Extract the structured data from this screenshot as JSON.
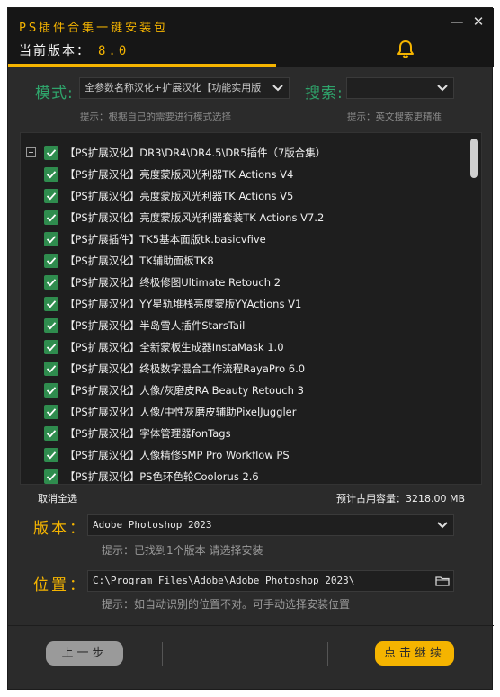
{
  "app": {
    "title": "PS插件合集一键安装包",
    "version_label": "当前版本：",
    "version_value": "8.0"
  },
  "colors": {
    "accent": "#f5b400",
    "green": "#2fa46b",
    "check": "#2f8c4e",
    "bg": "#2b2b2b"
  },
  "mode": {
    "label": "模式:",
    "value": "全参数名称汉化+扩展汉化【功能实用版",
    "hint": "提示：根据自己的需要进行模式选择"
  },
  "search": {
    "label": "搜索:",
    "value": "",
    "hint": "提示：英文搜索更精准"
  },
  "items": [
    {
      "label": "【PS扩展汉化】DR3\\DR4\\DR4.5\\DR5插件（7版合集）",
      "checked": true,
      "expander": true
    },
    {
      "label": "【PS扩展汉化】亮度蒙版风光利器TK Actions V4",
      "checked": true
    },
    {
      "label": "【PS扩展汉化】亮度蒙版风光利器TK Actions V5",
      "checked": true
    },
    {
      "label": "【PS扩展汉化】亮度蒙版风光利器套装TK Actions V7.2",
      "checked": true
    },
    {
      "label": "【PS扩展插件】TK5基本面版tk.basicvfive",
      "checked": true
    },
    {
      "label": "【PS扩展汉化】TK辅助面板TK8",
      "checked": true
    },
    {
      "label": "【PS扩展汉化】终极修图Ultimate Retouch 2",
      "checked": true
    },
    {
      "label": "【PS扩展汉化】YY星轨堆栈亮度蒙版YYActions V1",
      "checked": true
    },
    {
      "label": "【PS扩展汉化】半岛雪人插件StarsTail",
      "checked": true
    },
    {
      "label": "【PS扩展汉化】全新蒙板生成器InstaMask 1.0",
      "checked": true
    },
    {
      "label": "【PS扩展汉化】终极数字混合工作流程RayaPro 6.0",
      "checked": true
    },
    {
      "label": "【PS扩展汉化】人像/灰磨皮RA Beauty Retouch 3",
      "checked": true
    },
    {
      "label": "【PS扩展汉化】人像/中性灰磨皮辅助PixelJuggler",
      "checked": true
    },
    {
      "label": "【PS扩展汉化】字体管理器fonTags",
      "checked": true
    },
    {
      "label": "【PS扩展汉化】人像精修SMP Pro Workflow PS",
      "checked": true
    },
    {
      "label": "【PS扩展汉化】PS色环色轮Coolorus 2.6",
      "checked": true
    }
  ],
  "deselect_label": "取消全选",
  "capacity_label": "预计占用容量：3218.00 MB",
  "version_field": {
    "label": "版本：",
    "value": "Adobe Photoshop 2023",
    "hint": "提示：已找到1个版本 请选择安装"
  },
  "location_field": {
    "label": "位置：",
    "value": "C:\\Program Files\\Adobe\\Adobe Photoshop 2023\\",
    "hint": "提示：如自动识别的位置不对。可手动选择安装位置"
  },
  "buttons": {
    "back": "上一步",
    "next": "点击继续"
  },
  "icons": {
    "bell": "bell-icon",
    "minimize": "minimize-icon",
    "close": "close-icon",
    "folder": "folder-icon",
    "chevron": "chevron-down-icon"
  }
}
